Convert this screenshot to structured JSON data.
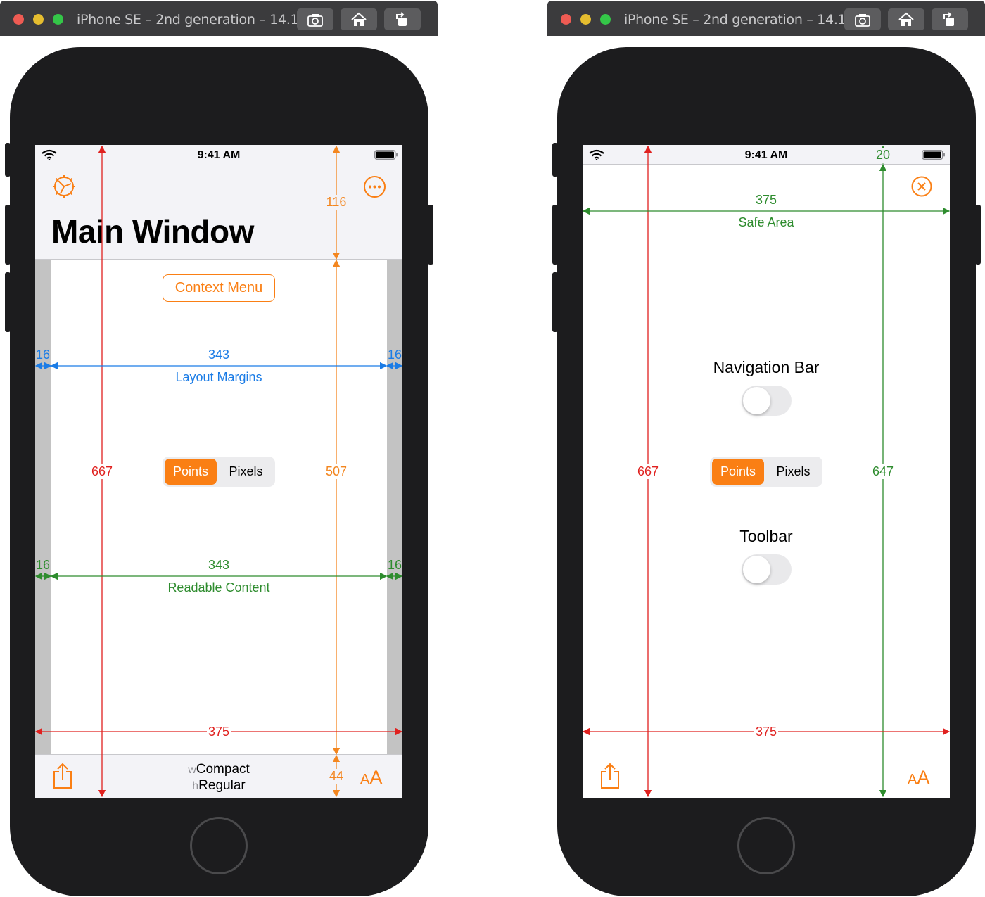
{
  "left_window": {
    "title": "iPhone SE – 2nd generation – 14.1",
    "toolbar_icons": [
      "screenshot-icon",
      "home-icon",
      "rotate-icon"
    ],
    "status_time": "9:41 AM",
    "nav_title": "Main Window",
    "context_menu_label": "Context Menu",
    "segment": {
      "selected": "Points",
      "other": "Pixels"
    },
    "size_class": {
      "w_prefix": "w",
      "w_value": "Compact",
      "h_prefix": "h",
      "h_value": "Regular"
    },
    "text_size_label": "AA",
    "measurements": {
      "layout_margins": {
        "left": "16",
        "width": "343",
        "right": "16",
        "label": "Layout Margins"
      },
      "readable_content": {
        "left": "16",
        "width": "343",
        "right": "16",
        "label": "Readable Content"
      },
      "screen_height": "667",
      "content_height": "507",
      "nav_height": "116",
      "toolbar_height": "44",
      "screen_width": "375"
    }
  },
  "right_window": {
    "title": "iPhone SE – 2nd generation – 14.1",
    "toolbar_icons": [
      "screenshot-icon",
      "home-icon",
      "rotate-icon"
    ],
    "status_time": "9:41 AM",
    "navigation_bar_label": "Navigation Bar",
    "navigation_bar_toggle": false,
    "toolbar_label": "Toolbar",
    "toolbar_toggle": false,
    "segment": {
      "selected": "Points",
      "other": "Pixels"
    },
    "text_size_label": "AA",
    "measurements": {
      "status_height": "20",
      "safe_area_width": "375",
      "safe_area_label": "Safe Area",
      "screen_height": "667",
      "safe_area_height": "647",
      "screen_width": "375"
    }
  },
  "colors": {
    "accent": "#fa7f14",
    "red": "#e0211f",
    "blue": "#1b7ce6",
    "green": "#2e8c2e",
    "orange_measure": "#f3861f"
  }
}
